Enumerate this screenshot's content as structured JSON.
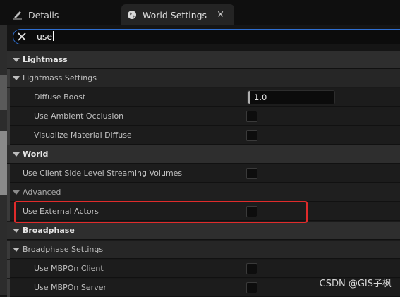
{
  "tabs": [
    {
      "label": "Details",
      "icon": "pencil-icon"
    },
    {
      "label": "World Settings",
      "icon": "globe-icon",
      "close": "×"
    }
  ],
  "search": {
    "value": "use"
  },
  "rows": {
    "lightmass": "Lightmass",
    "lightmass_settings": "Lightmass Settings",
    "diffuse_boost": "Diffuse Boost",
    "diffuse_boost_value": "1.0",
    "use_ambient_occlusion": "Use Ambient Occlusion",
    "visualize_material_diffuse": "Visualize Material Diffuse",
    "world": "World",
    "use_client_side": "Use Client Side Level Streaming Volumes",
    "advanced": "Advanced",
    "use_external_actors": "Use External Actors",
    "broadphase": "Broadphase",
    "broadphase_settings": "Broadphase Settings",
    "use_mbp_on_client": "Use MBPOn Client",
    "use_mbp_on_server": "Use MBPOn Server"
  },
  "watermark": "CSDN @GIS子枫",
  "colors": {
    "highlight": "#e02b2b",
    "search_border": "#2f6fd1"
  }
}
